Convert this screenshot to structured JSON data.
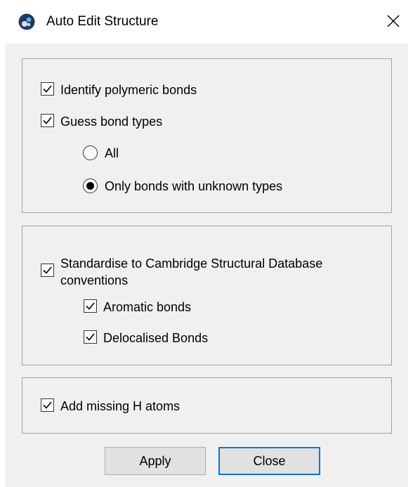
{
  "window": {
    "title": "Auto Edit Structure",
    "icon": "ccdc-logo-icon",
    "close_icon": "close-icon"
  },
  "group1": {
    "identify_polymeric": {
      "label": "Identify polymeric bonds",
      "checked": true
    },
    "guess_bond_types": {
      "label": "Guess bond types",
      "checked": true
    },
    "radio_all": {
      "label": "All",
      "selected": false
    },
    "radio_unknown": {
      "label": "Only bonds with unknown types",
      "selected": true
    }
  },
  "group2": {
    "standardise": {
      "label_line1": "Standardise to Cambridge Structural Database",
      "label_line2": "conventions",
      "checked": true
    },
    "aromatic": {
      "label": "Aromatic bonds",
      "checked": true
    },
    "delocalised": {
      "label": "Delocalised Bonds",
      "checked": true
    }
  },
  "group3": {
    "add_h": {
      "label": "Add missing H atoms",
      "checked": true
    }
  },
  "buttons": {
    "apply": "Apply",
    "close": "Close"
  },
  "colors": {
    "dialog_bg": "#f0f0f0",
    "accent": "#0078d7"
  }
}
